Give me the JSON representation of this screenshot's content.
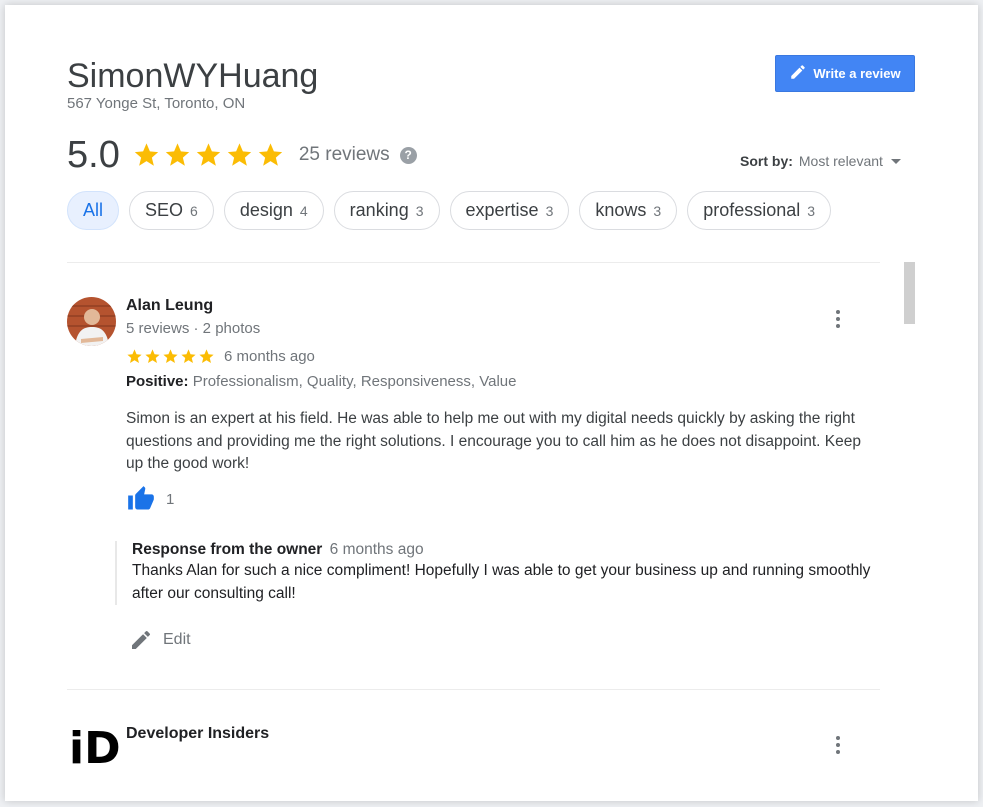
{
  "business": {
    "name": "SimonWYHuang",
    "address": "567 Yonge St, Toronto, ON"
  },
  "actions": {
    "write_review_label": "Write a review",
    "write_review_icon": "pencil-icon"
  },
  "summary": {
    "rating": "5.0",
    "stars": 5,
    "review_count": "25 reviews",
    "help_icon": "?"
  },
  "sort": {
    "label": "Sort by:",
    "value": "Most relevant"
  },
  "filters": [
    {
      "label": "All",
      "count": "",
      "active": true
    },
    {
      "label": "SEO",
      "count": "6",
      "active": false
    },
    {
      "label": "design",
      "count": "4",
      "active": false
    },
    {
      "label": "ranking",
      "count": "3",
      "active": false
    },
    {
      "label": "expertise",
      "count": "3",
      "active": false
    },
    {
      "label": "knows",
      "count": "3",
      "active": false
    },
    {
      "label": "professional",
      "count": "3",
      "active": false
    }
  ],
  "reviews": [
    {
      "name": "Alan Leung",
      "meta": "5 reviews · 2 photos",
      "stars": 5,
      "time": "6 months ago",
      "attributes_label": "Positive:",
      "attributes": "Professionalism, Quality, Responsiveness, Value",
      "text": "Simon is an expert at his field. He was able to help me out with my digital needs quickly by asking the right questions and providing me the right solutions. I encourage you to call him as he does not disappoint. Keep up the good work!",
      "likes": "1",
      "response": {
        "title": "Response from the owner",
        "time": "6 months ago",
        "text": "Thanks Alan for such a nice compliment! Hopefully I was able to get your business up and running smoothly after our consulting call!"
      },
      "edit_label": "Edit"
    },
    {
      "name": "Developer Insiders",
      "avatar_text": "iD"
    }
  ],
  "colors": {
    "star": "#fbbc04",
    "accent": "#4285f4",
    "like": "#1a73e8"
  }
}
